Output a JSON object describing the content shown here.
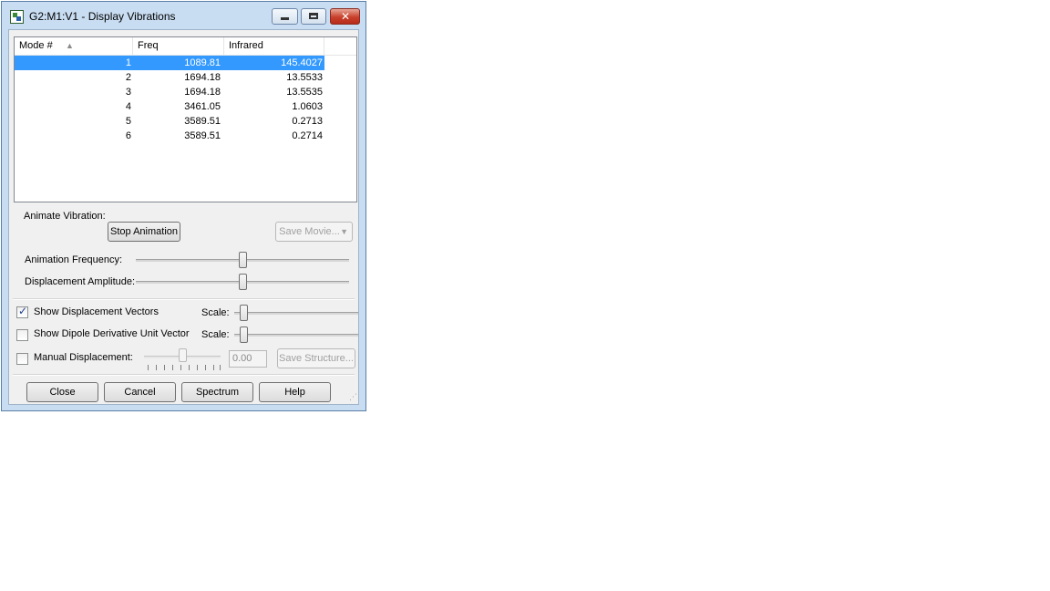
{
  "window": {
    "title": "G2:M1:V1 - Display Vibrations"
  },
  "listview": {
    "columns": [
      "Mode #",
      "Freq",
      "Infrared"
    ],
    "rows": [
      {
        "mode": "1",
        "freq": "1089.81",
        "infrared": "145.4027"
      },
      {
        "mode": "2",
        "freq": "1694.18",
        "infrared": "13.5533"
      },
      {
        "mode": "3",
        "freq": "1694.18",
        "infrared": "13.5535"
      },
      {
        "mode": "4",
        "freq": "3461.05",
        "infrared": "1.0603"
      },
      {
        "mode": "5",
        "freq": "3589.51",
        "infrared": "0.2713"
      },
      {
        "mode": "6",
        "freq": "3589.51",
        "infrared": "0.2714"
      }
    ],
    "selected_row": 0
  },
  "animate": {
    "label": "Animate Vibration:",
    "stop_button": "Stop Animation",
    "save_movie_button": "Save Movie...",
    "frequency_label": "Animation Frequency:",
    "frequency_level": 0.5,
    "amplitude_label": "Displacement Amplitude:",
    "amplitude_level": 0.5
  },
  "options": {
    "show_displacement_label": "Show Displacement Vectors",
    "show_displacement_checked": true,
    "show_dipole_label": "Show Dipole Derivative Unit Vector",
    "show_dipole_checked": false,
    "scale_label": "Scale:",
    "scale1_level": 0.05,
    "scale2_level": 0.05,
    "manual_label": "Manual Displacement:",
    "manual_checked": false,
    "manual_level": 0.5,
    "manual_value": "0.00",
    "save_structure_button": "Save Structure..."
  },
  "buttons": {
    "close": "Close",
    "cancel": "Cancel",
    "spectrum": "Spectrum",
    "help": "Help"
  },
  "colors": {
    "selection": "#3399ff",
    "titlebar": "#c9ddf2",
    "close_button": "#c8402c"
  },
  "icons": {
    "app": "gaussview-app-icon",
    "sort": "sort-ascending-icon",
    "check": "checkmark-icon"
  }
}
